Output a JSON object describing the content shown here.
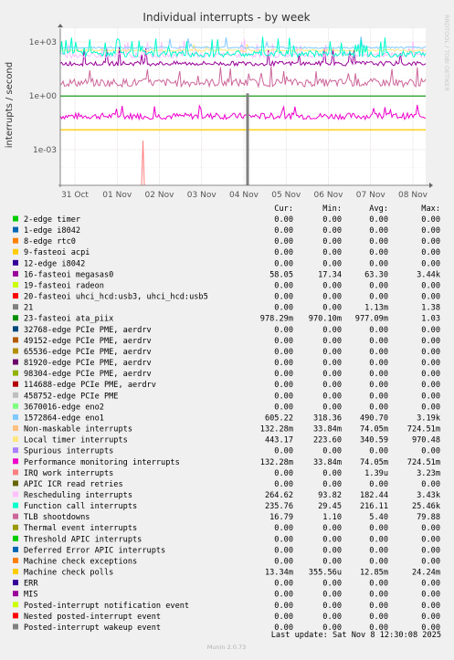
{
  "chart_data": {
    "type": "line",
    "title": "Individual interrupts - by week",
    "ylabel": "interrupts / second",
    "yscale": "log",
    "y_ticks": [
      "1e+03",
      "1e+00",
      "1e-03"
    ],
    "x_ticks": [
      "31 Oct",
      "01 Nov",
      "02 Nov",
      "03 Nov",
      "04 Nov",
      "05 Nov",
      "06 Nov",
      "07 Nov",
      "08 Nov"
    ],
    "watermark": "RRDTOOL / TOBI OETIKER",
    "grid": true,
    "legend_position": "bottom",
    "legend_header": [
      "Cur:",
      "Min:",
      "Avg:",
      "Max:"
    ],
    "series": [
      {
        "name": "2-edge      timer",
        "color": "#00cc00",
        "cur": "0.00",
        "min": "0.00",
        "avg": "0.00",
        "max": "0.00"
      },
      {
        "name": "1-edge      i8042",
        "color": "#0066b3",
        "cur": "0.00",
        "min": "0.00",
        "avg": "0.00",
        "max": "0.00"
      },
      {
        "name": "8-edge      rtc0",
        "color": "#ff8000",
        "cur": "0.00",
        "min": "0.00",
        "avg": "0.00",
        "max": "0.00"
      },
      {
        "name": "9-fasteoi   acpi",
        "color": "#ffcc00",
        "cur": "0.00",
        "min": "0.00",
        "avg": "0.00",
        "max": "0.00"
      },
      {
        "name": "12-edge      i8042",
        "color": "#330099",
        "cur": "0.00",
        "min": "0.00",
        "avg": "0.00",
        "max": "0.00"
      },
      {
        "name": "16-fasteoi   megasas0",
        "color": "#990099",
        "cur": "58.05",
        "min": "17.34",
        "avg": "63.30",
        "max": "3.44k"
      },
      {
        "name": "19-fasteoi   radeon",
        "color": "#ccff00",
        "cur": "0.00",
        "min": "0.00",
        "avg": "0.00",
        "max": "0.00"
      },
      {
        "name": "20-fasteoi   uhci_hcd:usb3, uhci_hcd:usb5",
        "color": "#ff0000",
        "cur": "0.00",
        "min": "0.00",
        "avg": "0.00",
        "max": "0.00"
      },
      {
        "name": "21",
        "color": "#808080",
        "cur": "0.00",
        "min": "0.00",
        "avg": "1.13m",
        "max": "1.38"
      },
      {
        "name": "23-fasteoi   ata_piix",
        "color": "#008f00",
        "cur": "978.29m",
        "min": "970.10m",
        "avg": "977.09m",
        "max": "1.03"
      },
      {
        "name": "32768-edge      PCIe PME, aerdrv",
        "color": "#00487d",
        "cur": "0.00",
        "min": "0.00",
        "avg": "0.00",
        "max": "0.00"
      },
      {
        "name": "49152-edge      PCIe PME, aerdrv",
        "color": "#b35a00",
        "cur": "0.00",
        "min": "0.00",
        "avg": "0.00",
        "max": "0.00"
      },
      {
        "name": "65536-edge      PCIe PME, aerdrv",
        "color": "#b38f00",
        "cur": "0.00",
        "min": "0.00",
        "avg": "0.00",
        "max": "0.00"
      },
      {
        "name": "81920-edge      PCIe PME, aerdrv",
        "color": "#6b006b",
        "cur": "0.00",
        "min": "0.00",
        "avg": "0.00",
        "max": "0.00"
      },
      {
        "name": "98304-edge      PCIe PME, aerdrv",
        "color": "#8fb300",
        "cur": "0.00",
        "min": "0.00",
        "avg": "0.00",
        "max": "0.00"
      },
      {
        "name": "114688-edge      PCIe PME, aerdrv",
        "color": "#b30000",
        "cur": "0.00",
        "min": "0.00",
        "avg": "0.00",
        "max": "0.00"
      },
      {
        "name": "458752-edge      PCIe PME",
        "color": "#bebebe",
        "cur": "0.00",
        "min": "0.00",
        "avg": "0.00",
        "max": "0.00"
      },
      {
        "name": "3670016-edge      eno2",
        "color": "#80ff80",
        "cur": "0.00",
        "min": "0.00",
        "avg": "0.00",
        "max": "0.00"
      },
      {
        "name": "1572864-edge      eno1",
        "color": "#80c9ff",
        "cur": "605.22",
        "min": "318.36",
        "avg": "490.70",
        "max": "3.19k"
      },
      {
        "name": "Non-maskable interrupts",
        "color": "#ffc080",
        "cur": "132.28m",
        "min": "33.84m",
        "avg": "74.05m",
        "max": "724.51m"
      },
      {
        "name": "Local timer interrupts",
        "color": "#ffe680",
        "cur": "443.17",
        "min": "223.60",
        "avg": "340.59",
        "max": "970.48"
      },
      {
        "name": "Spurious interrupts",
        "color": "#aa80ff",
        "cur": "0.00",
        "min": "0.00",
        "avg": "0.00",
        "max": "0.00"
      },
      {
        "name": "Performance monitoring interrupts",
        "color": "#ee00cc",
        "cur": "132.28m",
        "min": "33.84m",
        "avg": "74.05m",
        "max": "724.51m"
      },
      {
        "name": "IRQ work interrupts",
        "color": "#ff8080",
        "cur": "0.00",
        "min": "0.00",
        "avg": "1.39u",
        "max": "3.23m"
      },
      {
        "name": "APIC ICR read retries",
        "color": "#666600",
        "cur": "0.00",
        "min": "0.00",
        "avg": "0.00",
        "max": "0.00"
      },
      {
        "name": "Rescheduling interrupts",
        "color": "#ffbfff",
        "cur": "264.62",
        "min": "93.82",
        "avg": "182.44",
        "max": "3.43k"
      },
      {
        "name": "Function call interrupts",
        "color": "#00ffcc",
        "cur": "235.76",
        "min": "29.45",
        "avg": "216.11",
        "max": "25.46k"
      },
      {
        "name": "TLB shootdowns",
        "color": "#cc6699",
        "cur": "16.79",
        "min": "1.10",
        "avg": "5.40",
        "max": "79.88"
      },
      {
        "name": "Thermal event interrupts",
        "color": "#999900",
        "cur": "0.00",
        "min": "0.00",
        "avg": "0.00",
        "max": "0.00"
      },
      {
        "name": "Threshold APIC interrupts",
        "color": "#00cc00",
        "cur": "0.00",
        "min": "0.00",
        "avg": "0.00",
        "max": "0.00"
      },
      {
        "name": "Deferred Error APIC interrupts",
        "color": "#0066b3",
        "cur": "0.00",
        "min": "0.00",
        "avg": "0.00",
        "max": "0.00"
      },
      {
        "name": "Machine check exceptions",
        "color": "#ff8000",
        "cur": "0.00",
        "min": "0.00",
        "avg": "0.00",
        "max": "0.00"
      },
      {
        "name": "Machine check polls",
        "color": "#ffcc00",
        "cur": "13.34m",
        "min": "355.56u",
        "avg": "12.85m",
        "max": "24.24m"
      },
      {
        "name": "ERR",
        "color": "#330099",
        "cur": "0.00",
        "min": "0.00",
        "avg": "0.00",
        "max": "0.00"
      },
      {
        "name": "MIS",
        "color": "#990099",
        "cur": "0.00",
        "min": "0.00",
        "avg": "0.00",
        "max": "0.00"
      },
      {
        "name": "Posted-interrupt notification event",
        "color": "#ccff00",
        "cur": "0.00",
        "min": "0.00",
        "avg": "0.00",
        "max": "0.00"
      },
      {
        "name": "Nested posted-interrupt event",
        "color": "#ff0000",
        "cur": "0.00",
        "min": "0.00",
        "avg": "0.00",
        "max": "0.00"
      },
      {
        "name": "Posted-interrupt wakeup event",
        "color": "#808080",
        "cur": "0.00",
        "min": "0.00",
        "avg": "0.00",
        "max": "0.00"
      }
    ]
  },
  "last_update": "Last update:  Sat Nov  8 12:30:08 2025",
  "footer": "Munin 2.0.73"
}
